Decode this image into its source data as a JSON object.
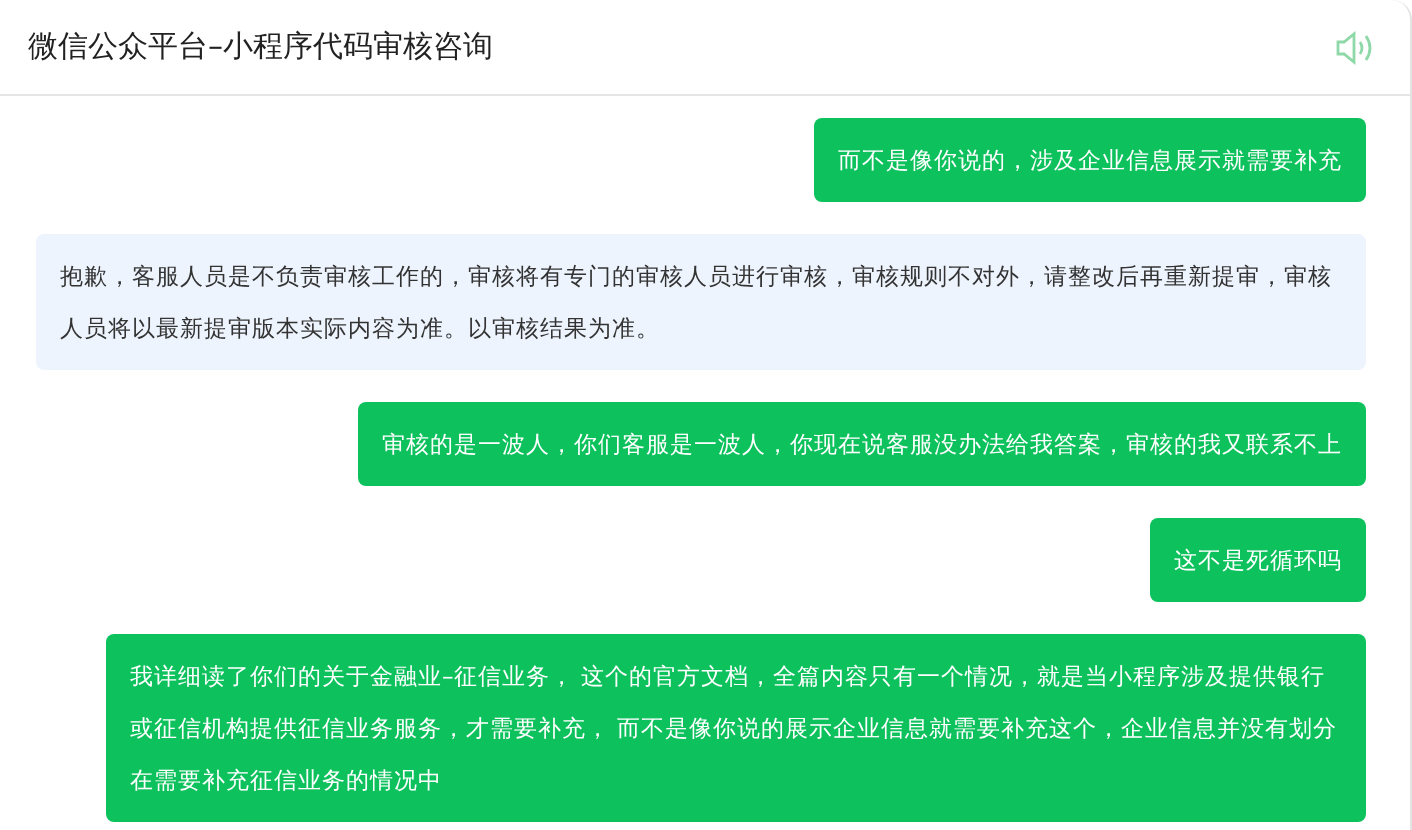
{
  "header": {
    "title": "微信公众平台–小程序代码审核咨询"
  },
  "messages": [
    {
      "kind": "sent",
      "text": "而不是像你说的，涉及企业信息展示就需要补充"
    },
    {
      "kind": "received",
      "text": "抱歉，客服人员是不负责审核工作的，审核将有专门的审核人员进行审核，审核规则不对外，请整改后再重新提审，审核人员将以最新提审版本实际内容为准。以审核结果为准。"
    },
    {
      "kind": "sent",
      "text": "审核的是一波人，你们客服是一波人，你现在说客服没办法给我答案，审核的我又联系不上"
    },
    {
      "kind": "sent",
      "text": "这不是死循环吗"
    },
    {
      "kind": "sent",
      "text": "我详细读了你们的关于金融业–征信业务， 这个的官方文档，全篇内容只有一个情况，就是当小程序涉及提供银行或征信机构提供征信业务服务，才需要补充， 而不是像你说的展示企业信息就需要补充这个，企业信息并没有划分在需要补充征信业务的情况中"
    }
  ]
}
